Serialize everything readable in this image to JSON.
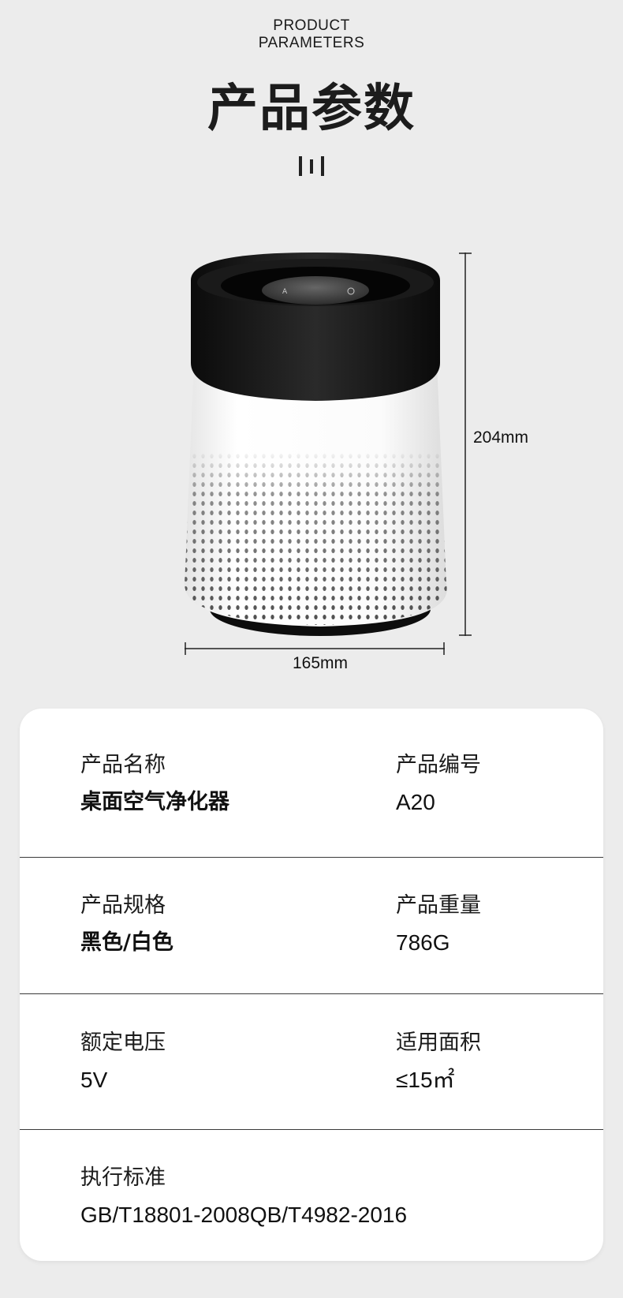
{
  "header": {
    "title_en": "PRODUCT\nPARAMETERS",
    "title_cn": "产品参数"
  },
  "dimensions": {
    "height": "204mm",
    "width": "165mm"
  },
  "specs": [
    {
      "left": {
        "label": "产品名称",
        "value": "桌面空气净化器"
      },
      "right": {
        "label": "产品编号",
        "value": "A20"
      }
    },
    {
      "left": {
        "label": "产品规格",
        "value": "黑色/白色"
      },
      "right": {
        "label": "产品重量",
        "value": "786G"
      }
    },
    {
      "left": {
        "label": "额定电压",
        "value": "5V"
      },
      "right": {
        "label": "适用面积",
        "value": "≤15㎡"
      }
    },
    {
      "left": {
        "label": "执行标准",
        "value": "GB/T18801-2008QB/T4982-2016"
      }
    }
  ],
  "colors": {
    "background": "#ececec",
    "card": "#ffffff",
    "product_top": "#111111"
  }
}
